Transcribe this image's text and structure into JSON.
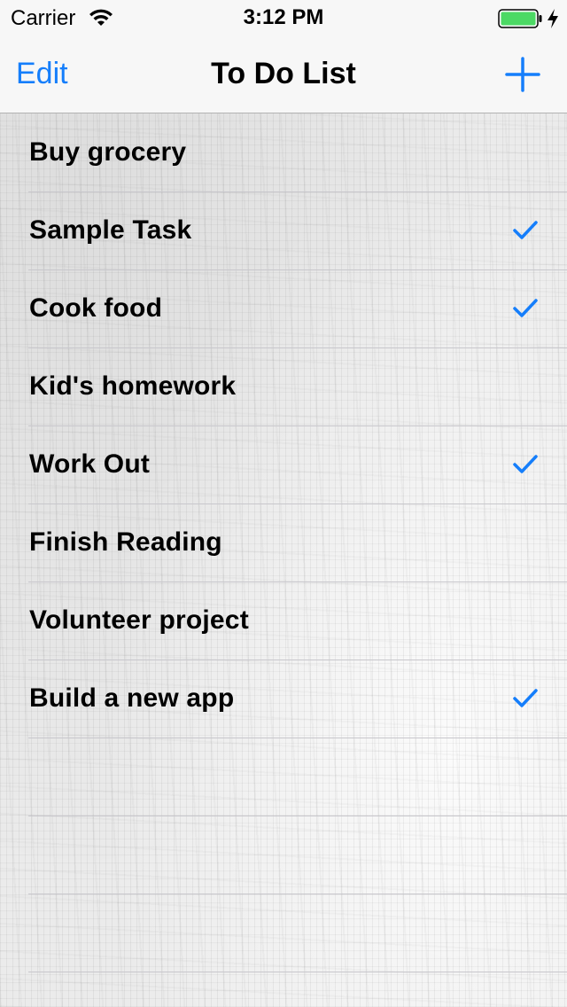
{
  "status_bar": {
    "carrier": "Carrier",
    "time": "3:12 PM",
    "wifi_icon": "wifi-icon",
    "battery_icon": "battery-icon",
    "battery_color": "#4cd964"
  },
  "nav_bar": {
    "edit_label": "Edit",
    "title": "To Do List",
    "add_icon": "plus-icon",
    "accent_color": "#157efb"
  },
  "tasks": [
    {
      "label": "Buy grocery",
      "checked": false
    },
    {
      "label": "Sample Task",
      "checked": true
    },
    {
      "label": "Cook food",
      "checked": true
    },
    {
      "label": "Kid's homework",
      "checked": false
    },
    {
      "label": "Work Out",
      "checked": true
    },
    {
      "label": "Finish Reading",
      "checked": false
    },
    {
      "label": "Volunteer project",
      "checked": false
    },
    {
      "label": "Build a new app",
      "checked": true
    }
  ],
  "empty_rows": 3
}
